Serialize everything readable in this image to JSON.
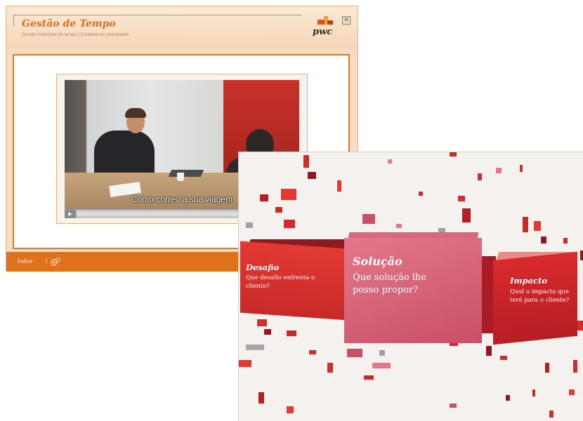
{
  "module": {
    "title": "Gestão de Tempo",
    "subtitle": "Gestão individual do tempo | Estabelecer prioridades",
    "logo_text": "pwc",
    "close_glyph": "✕"
  },
  "video": {
    "caption": "Como correu a sua viagem",
    "play_glyph": "▶",
    "progress": 0.0
  },
  "footer": {
    "index_label": "Índice",
    "separator": "|",
    "settings_icon": "gears-icon"
  },
  "intro_slide": {
    "panels": [
      {
        "title": "Desafio",
        "question": "Que desafio enfrenta o cliente?"
      },
      {
        "title": "Solução",
        "question": "Que solução lhe posso propor?"
      },
      {
        "title": "Impacto",
        "question": "Qual o impacto que terá para o cliente?"
      }
    ]
  },
  "colors": {
    "accent_orange": "#e0721c",
    "pwc_red": "#c82a28",
    "solution_pink": "#d05a70"
  }
}
